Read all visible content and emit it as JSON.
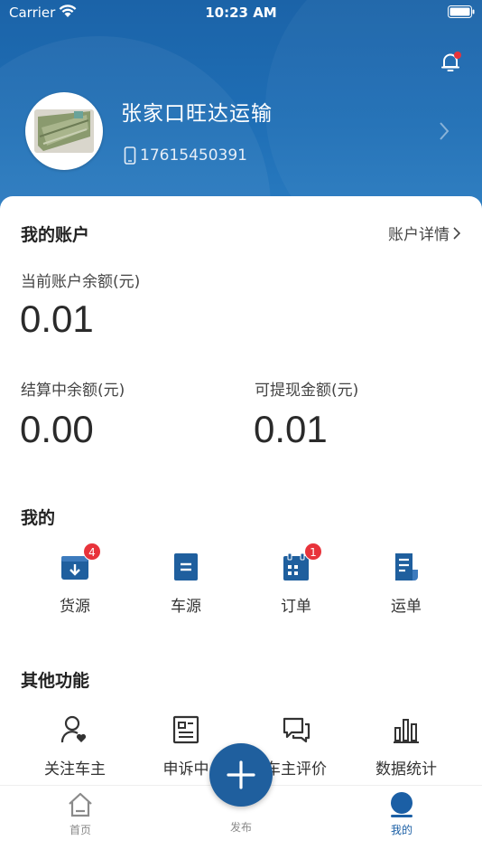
{
  "status_bar": {
    "carrier": "Carrier",
    "time": "10:23 AM"
  },
  "profile": {
    "company_name": "张家口旺达运输",
    "phone": "17615450391"
  },
  "account": {
    "title": "我的账户",
    "detail_link": "账户详情",
    "balance_label": "当前账户余额(元)",
    "balance_value": "0.01",
    "settling_label": "结算中余额(元)",
    "settling_value": "0.00",
    "withdrawable_label": "可提现金额(元)",
    "withdrawable_value": "0.01"
  },
  "mine": {
    "title": "我的",
    "items": [
      {
        "label": "货源",
        "icon": "cargo-source-icon",
        "badge": "4"
      },
      {
        "label": "车源",
        "icon": "vehicle-source-icon",
        "badge": ""
      },
      {
        "label": "订单",
        "icon": "order-icon",
        "badge": "1"
      },
      {
        "label": "运单",
        "icon": "waybill-icon",
        "badge": ""
      }
    ]
  },
  "other": {
    "title": "其他功能",
    "items": [
      {
        "label": "关注车主",
        "icon": "follow-driver-icon"
      },
      {
        "label": "申诉中",
        "icon": "complaint-icon"
      },
      {
        "label": "车主评价",
        "icon": "driver-review-icon"
      },
      {
        "label": "数据统计",
        "icon": "statistics-icon"
      }
    ]
  },
  "tabbar": {
    "home": "首页",
    "publish": "发布",
    "mine": "我的"
  },
  "colors": {
    "header_blue": "#1f6fb6",
    "primary_blue": "#1b5fa5",
    "badge_red": "#e8333b"
  }
}
